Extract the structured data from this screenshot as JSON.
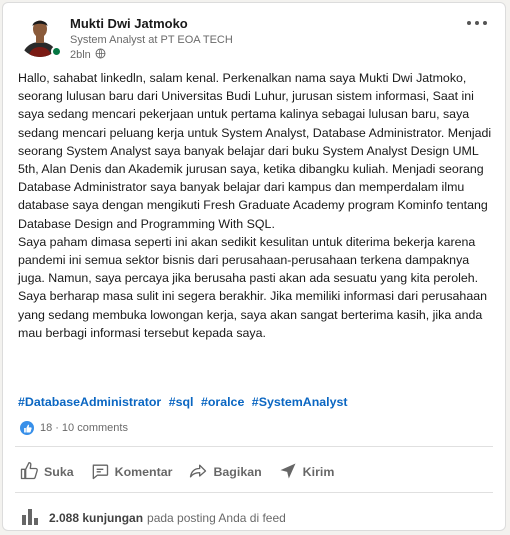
{
  "post": {
    "author": {
      "name": "Mukti Dwi Jatmoko",
      "headline": "System Analyst at PT EOA TECH",
      "time": "2bln"
    },
    "paragraphs": [
      "Hallo, sahabat linkedln, salam kenal. Perkenalkan nama saya Mukti Dwi Jatmoko, seorang lulusan baru dari Universitas Budi Luhur, jurusan sistem informasi, Saat ini saya sedang mencari pekerjaan untuk pertama kalinya sebagai lulusan baru, saya sedang mencari peluang kerja untuk System Analyst, Database Administrator. Menjadi seorang System Analyst saya banyak belajar dari buku System Analyst Design UML 5th, Alan Denis dan Akademik jurusan saya, ketika dibangku kuliah. Menjadi seorang Database Administrator saya banyak belajar dari kampus dan memperdalam ilmu database saya dengan mengikuti Fresh Graduate Academy program Kominfo tentang Database Design and Programming With SQL.",
      "Saya paham dimasa seperti ini akan sedikit kesulitan untuk diterima bekerja karena pandemi ini semua sektor bisnis dari perusahaan-perusahaan terkena dampaknya juga. Namun, saya percaya jika berusaha pasti akan ada sesuatu yang kita peroleh. Saya berharap masa sulit ini segera berakhir. Jika memiliki informasi dari perusahaan yang sedang membuka lowongan kerja, saya akan sangat berterima kasih, jika anda mau berbagi informasi tersebut kepada saya."
    ],
    "hashtags": [
      "#DatabaseAdministrator",
      "#sql",
      "#oralce",
      "#SystemAnalyst"
    ],
    "reactions": {
      "count": "18",
      "separator": "·",
      "comments": "10 comments"
    }
  },
  "actions": {
    "like": "Suka",
    "comment": "Komentar",
    "share": "Bagikan",
    "send": "Kirim"
  },
  "views": {
    "count": "2.088 kunjungan",
    "suffix": "pada posting Anda di feed"
  },
  "colors": {
    "accent": "#0a66c2",
    "online": "#057642",
    "like_badge": "#378fe9"
  }
}
